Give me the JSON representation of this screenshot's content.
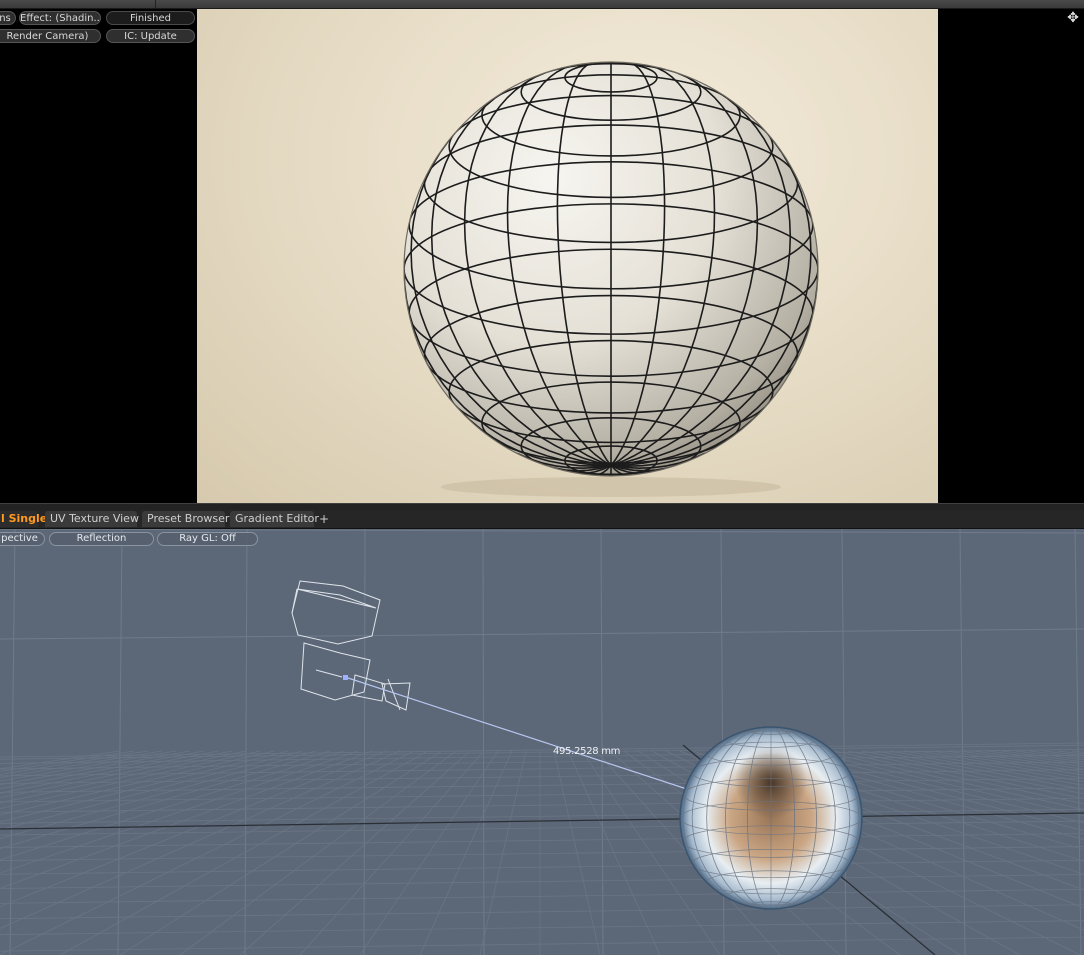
{
  "render_toolbar": {
    "options_button": "ns",
    "effect_button": "Effect: (Shadin...",
    "status_button": "Finished",
    "camera_button": "Render Camera)",
    "ic_button": "IC: Update"
  },
  "tabs": [
    {
      "label": "l Single",
      "active": true
    },
    {
      "label": "UV Texture View",
      "active": false
    },
    {
      "label": "Preset Browser",
      "active": false
    },
    {
      "label": "Gradient Editor",
      "active": false
    }
  ],
  "add_tab_label": "+",
  "viewport_toolbar": {
    "view_button": "pective",
    "shading_button": "Reflection",
    "raygl_button": "Ray GL: Off"
  },
  "measurement": {
    "distance_label": "495.2528 mm"
  },
  "icons": {
    "move": "move-arrows-icon"
  },
  "colors": {
    "active_tab_text": "#ff9a1f",
    "viewport_bg": "#5c6878",
    "render_bg": "#e8dec8"
  }
}
